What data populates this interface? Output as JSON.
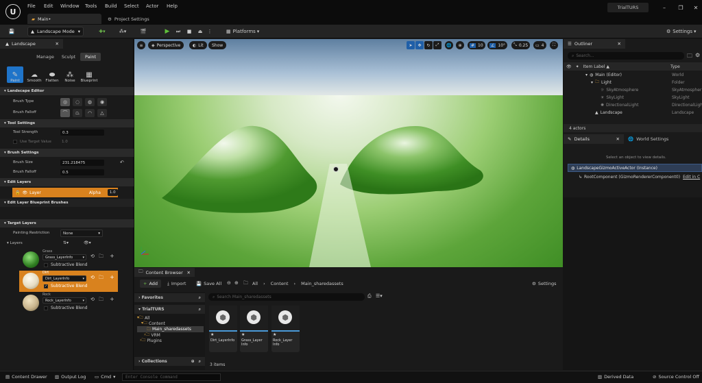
{
  "app": {
    "menu": [
      "File",
      "Edit",
      "Window",
      "Tools",
      "Build",
      "Select",
      "Actor",
      "Help"
    ],
    "tabs": {
      "main": "Main•",
      "project_settings": "Project Settings"
    },
    "project_name": "TrialTURS"
  },
  "toolbar": {
    "mode": "Landscape Mode",
    "platforms": "Platforms",
    "settings": "Settings"
  },
  "landscape_panel": {
    "tab": "Landscape",
    "modes": [
      "Manage",
      "Sculpt",
      "Paint"
    ],
    "tools": [
      "Paint",
      "Smooth",
      "Flatten",
      "Noise",
      "Blueprint"
    ],
    "sections": {
      "editor": "Landscape Editor",
      "tool_settings": "Tool Settings",
      "brush_settings": "Brush Settings",
      "edit_layers": "Edit Layers",
      "edit_layer_bp": "Edit Layer Blueprint Brushes",
      "target_layers": "Target Layers"
    },
    "labels": {
      "brush_type": "Brush Type",
      "brush_falloff": "Brush Falloff",
      "tool_strength": "Tool Strength",
      "use_target": "Use Target Value",
      "brush_size": "Brush Size",
      "brush_falloff2": "Brush Falloff",
      "layer": "Layer",
      "alpha": "Alpha",
      "painting_restriction": "Painting Restriction",
      "layers": "Layers"
    },
    "values": {
      "tool_strength": "0.3",
      "use_target": "1.0",
      "brush_size": "231.218475",
      "falloff": "0.5",
      "alpha": "1.0",
      "painting_restriction": "None"
    },
    "target_layers": [
      {
        "name": "Grass",
        "info": "Grass_LayerInfo",
        "blend": "Subtractive Blend",
        "color": "#2f7d21"
      },
      {
        "name": "Dirt",
        "info": "Dirt_LayerInfo",
        "blend": "Subtractive Blend",
        "color": "#e6dcc2"
      },
      {
        "name": "Rock",
        "info": "Rock_LayerInfo",
        "blend": "Subtractive Blend",
        "color": "#c8b48c"
      }
    ]
  },
  "viewport": {
    "perspective": "Perspective",
    "lit": "Lit",
    "show": "Show",
    "grid": "10",
    "angle": "10°",
    "scale": "0.25",
    "camera": "4"
  },
  "outliner": {
    "tab": "Outliner",
    "search_placeholder": "Search...",
    "col_label": "Item Label ▲",
    "col_type": "Type",
    "rows": [
      {
        "label": "Main (Editor)",
        "type": "World"
      },
      {
        "label": "Light",
        "type": "Folder"
      },
      {
        "label": "SkyAtmosphere",
        "type": "SkyAtmospher"
      },
      {
        "label": "SkyLight",
        "type": "SkyLight"
      },
      {
        "label": "DirectionalLight",
        "type": "DirectionalLigh"
      },
      {
        "label": "Landscape",
        "type": "Landscape"
      }
    ],
    "count": "4 actors"
  },
  "details": {
    "tab": "Details",
    "world_tab": "World Settings",
    "hint": "Select an object to view details.",
    "actor": "LandscapeGizmoActiveActor (Instance)",
    "component": "RootComponent (GizmoRendererComponent0)",
    "edit": "Edit in C"
  },
  "content_browser": {
    "tab": "Content Browser",
    "add": "Add",
    "import": "Import",
    "save_all": "Save All",
    "settings": "Settings",
    "crumbs": [
      "All",
      "Content",
      "Main_sharedassets"
    ],
    "favorites": "Favorites",
    "project": "TrialTURS",
    "search_placeholder": "Search Main_sharedassets",
    "tree": [
      "All",
      "Content",
      "Main_sharedassets",
      "VRM",
      "Plugins"
    ],
    "collections": "Collections",
    "assets": [
      {
        "name": "Dirt_LayerInfo"
      },
      {
        "name": "Grass_Layer Info"
      },
      {
        "name": "Rock_Layer Info"
      }
    ],
    "count": "3 items"
  },
  "statusbar": {
    "content_drawer": "Content Drawer",
    "output_log": "Output Log",
    "cmd": "Cmd",
    "console_placeholder": "Enter Console Command",
    "derived": "Derived Data",
    "source": "Source Control Off"
  }
}
